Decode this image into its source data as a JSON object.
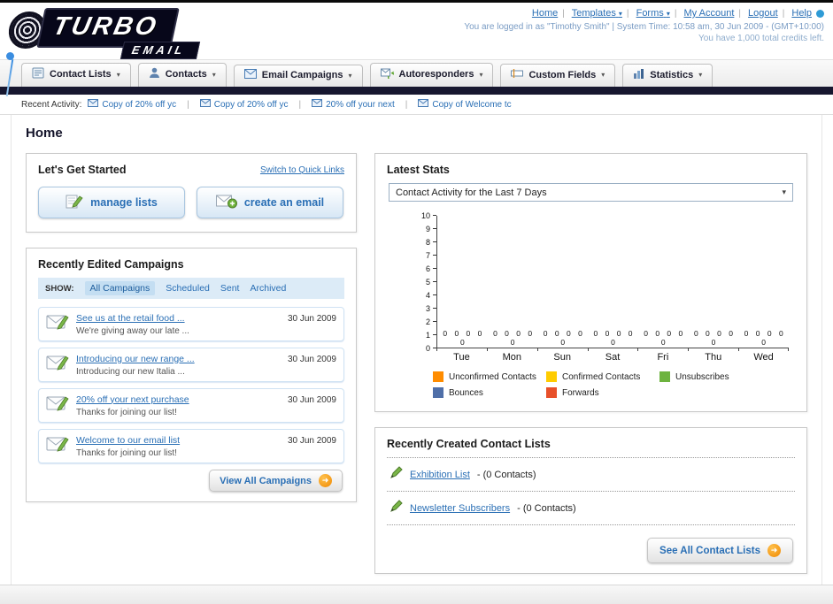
{
  "icons": {
    "chevron_down": "▾",
    "arrow_right": "➜"
  },
  "header": {
    "logo_line1": "TURBO",
    "logo_line2": "EMAIL",
    "nav": [
      "Home",
      "Templates",
      "Forms",
      "My Account",
      "Logout",
      "Help"
    ],
    "login_line": "You are logged in as \"Timothy Smith\" | System Time: 10:58 am, 30 Jun 2009 - (GMT+10:00)",
    "credits_line": "You have 1,000 total credits left."
  },
  "main_nav": {
    "items": [
      {
        "label": "Contact Lists"
      },
      {
        "label": "Contacts"
      },
      {
        "label": "Email Campaigns"
      },
      {
        "label": "Autoresponders"
      },
      {
        "label": "Custom Fields"
      },
      {
        "label": "Statistics"
      }
    ]
  },
  "recent_activity": {
    "label": "Recent Activity:",
    "items": [
      "Copy of 20% off yc",
      "Copy of 20% off yc",
      "20% off your next",
      "Copy of Welcome tc"
    ]
  },
  "page": {
    "title": "Home"
  },
  "get_started": {
    "title": "Let's Get Started",
    "switch_link": "Switch to Quick Links",
    "manage_lists_button": "manage lists",
    "create_email_button": "create an email"
  },
  "campaigns": {
    "title": "Recently Edited Campaigns",
    "show_label": "SHOW:",
    "filters": [
      "All Campaigns",
      "Scheduled",
      "Sent",
      "Archived"
    ],
    "items": [
      {
        "title": "See us at the retail food ...",
        "subtitle": "We're giving away our late ...",
        "date": "30 Jun 2009"
      },
      {
        "title": "Introducing our new range ...",
        "subtitle": "Introducing our new Italia ...",
        "date": "30 Jun 2009"
      },
      {
        "title": "20% off your next purchase",
        "subtitle": "Thanks for joining our list!",
        "date": "30 Jun 2009"
      },
      {
        "title": "Welcome to our email list",
        "subtitle": "Thanks for joining our list!",
        "date": "30 Jun 2009"
      }
    ],
    "view_all_button": "View All Campaigns"
  },
  "stats": {
    "title": "Latest Stats",
    "selected_option": "Contact Activity for the Last 7 Days"
  },
  "chart_data": {
    "type": "bar",
    "title": "Contact Activity for the Last 7 Days",
    "categories": [
      "Tue",
      "Mon",
      "Sun",
      "Sat",
      "Fri",
      "Thu",
      "Wed"
    ],
    "series": [
      {
        "name": "Unconfirmed Contacts",
        "color": "#ff8c00",
        "values": [
          0,
          0,
          0,
          0,
          0,
          0,
          0
        ]
      },
      {
        "name": "Confirmed Contacts",
        "color": "#ffcc00",
        "values": [
          0,
          0,
          0,
          0,
          0,
          0,
          0
        ]
      },
      {
        "name": "Unsubscribes",
        "color": "#6db33f",
        "values": [
          0,
          0,
          0,
          0,
          0,
          0,
          0
        ]
      },
      {
        "name": "Bounces",
        "color": "#4f6fa8",
        "values": [
          0,
          0,
          0,
          0,
          0,
          0,
          0
        ]
      },
      {
        "name": "Forwards",
        "color": "#e8502a",
        "values": [
          0,
          0,
          0,
          0,
          0,
          0,
          0
        ]
      }
    ],
    "ylim": [
      0,
      10
    ],
    "ytick_step": 1,
    "grid": false,
    "legend_position": "bottom",
    "show_value_labels": true
  },
  "contact_lists": {
    "title": "Recently Created Contact Lists",
    "items": [
      {
        "name": "Exhibition List",
        "detail": "- (0 Contacts)"
      },
      {
        "name": "Newsletter Subscribers",
        "detail": "- (0 Contacts)"
      }
    ],
    "see_all_button": "See All Contact Lists"
  }
}
